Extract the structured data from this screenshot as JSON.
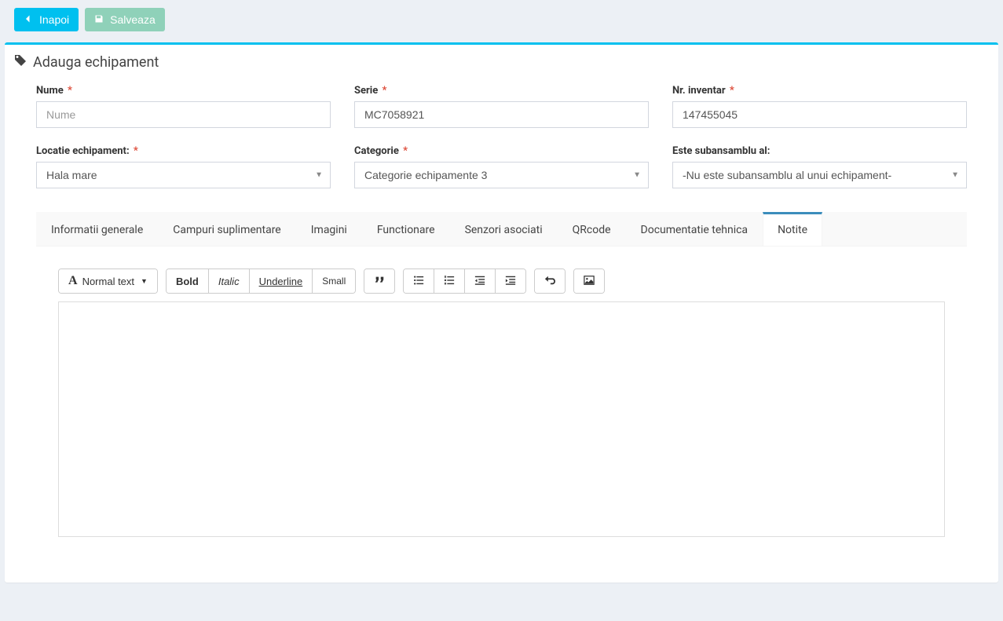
{
  "actions": {
    "back": "Inapoi",
    "save": "Salveaza"
  },
  "page": {
    "title": "Adauga echipament"
  },
  "form": {
    "nume": {
      "label": "Nume",
      "required": true,
      "placeholder": "Nume",
      "value": ""
    },
    "serie": {
      "label": "Serie",
      "required": true,
      "placeholder": "",
      "value": "MC7058921"
    },
    "inventar": {
      "label": "Nr. inventar",
      "required": true,
      "placeholder": "",
      "value": "147455045"
    },
    "locatie": {
      "label": "Locatie echipament:",
      "required": true,
      "value": "Hala mare"
    },
    "categorie": {
      "label": "Categorie",
      "required": true,
      "value": "Categorie echipamente 3"
    },
    "subansamblu": {
      "label": "Este subansamblu al:",
      "required": false,
      "value": "-Nu este subansamblu al unui echipament-"
    }
  },
  "tabs": [
    "Informatii generale",
    "Campuri suplimentare",
    "Imagini",
    "Functionare",
    "Senzori asociati",
    "QRcode",
    "Documentatie tehnica",
    "Notite"
  ],
  "active_tab_index": 7,
  "editor": {
    "style_dropdown": "Normal text",
    "bold": "Bold",
    "italic": "Italic",
    "underline": "Underline",
    "small": "Small",
    "content": ""
  },
  "required_marker": "*"
}
